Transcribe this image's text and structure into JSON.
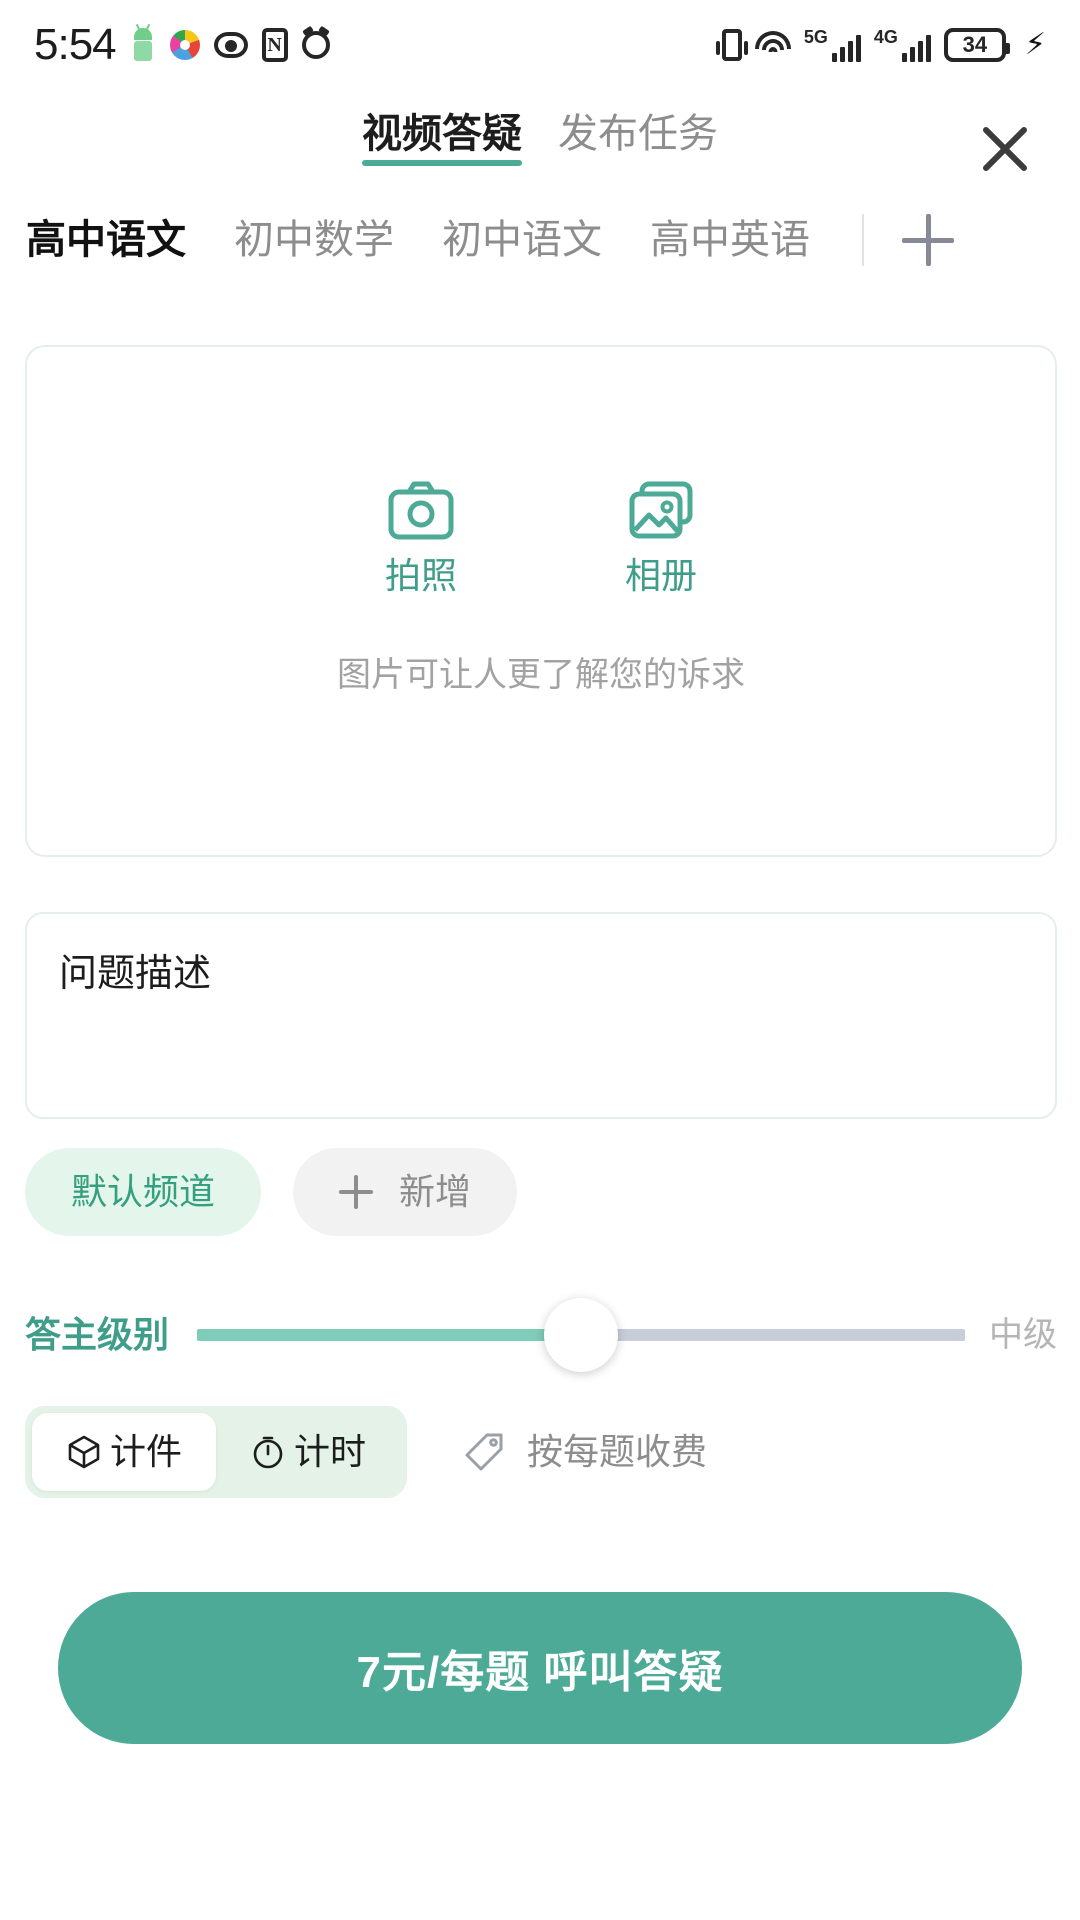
{
  "status_bar": {
    "time": "5:54",
    "battery_percent": "34",
    "network_5g": "5G",
    "network_4g": "4G",
    "icons": [
      "android-icon",
      "swirl-icon",
      "eye-icon",
      "nfc-icon",
      "alarm-icon",
      "vibrate-icon",
      "wifi-icon",
      "signal-5g-icon",
      "signal-4g-icon",
      "battery-icon",
      "charging-bolt-icon"
    ]
  },
  "header": {
    "tabs": [
      {
        "label": "视频答疑",
        "active": true
      },
      {
        "label": "发布任务",
        "active": false
      }
    ],
    "close_icon": "close-icon"
  },
  "subjects": {
    "items": [
      {
        "label": "高中语文",
        "active": true
      },
      {
        "label": "初中数学",
        "active": false
      },
      {
        "label": "初中语文",
        "active": false
      },
      {
        "label": "高中英语",
        "active": false
      }
    ],
    "add_icon": "plus-icon"
  },
  "upload": {
    "camera": {
      "label": "拍照",
      "icon": "camera-icon"
    },
    "album": {
      "label": "相册",
      "icon": "image-icon"
    },
    "hint": "图片可让人更了解您的诉求"
  },
  "description": {
    "placeholder": "问题描述",
    "value": "问题描述"
  },
  "channels": {
    "selected": "默认频道",
    "add_label": "新增",
    "add_icon": "plus-icon"
  },
  "level_slider": {
    "label": "答主级别",
    "value_label": "中级",
    "percent": 50
  },
  "pricing": {
    "modes": [
      {
        "label": "计件",
        "icon": "cube-icon",
        "active": true
      },
      {
        "label": "计时",
        "icon": "stopwatch-icon",
        "active": false
      }
    ],
    "fee_note": "按每题收费",
    "fee_icon": "price-tag-icon"
  },
  "cta": {
    "label": "7元/每题 呼叫答疑"
  },
  "colors": {
    "accent": "#4caa96",
    "accent_text": "#3f9e89",
    "chip_green_bg": "#e4f5eb",
    "chip_gray_bg": "#f2f2f2",
    "muted_text": "#8d8d8d",
    "track": "#c7cdd9",
    "track_fill": "#7fcdb9"
  }
}
